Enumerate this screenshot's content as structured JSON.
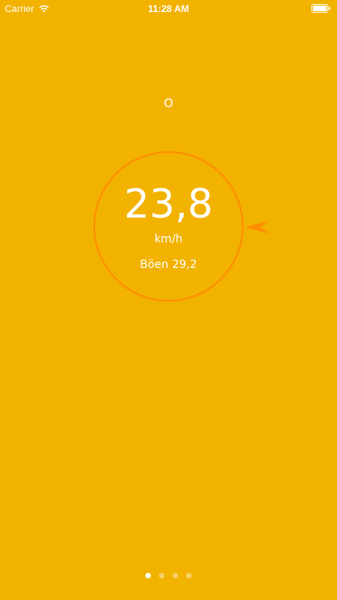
{
  "status_bar": {
    "carrier": "Carrier",
    "time": "11:28 AM",
    "wifi_icon": "wifi-icon",
    "battery_icon": "battery-icon"
  },
  "wind": {
    "direction": "O",
    "speed": "23,8",
    "unit": "km/h",
    "gust": "Böen 29,2",
    "pointer_icon": "direction-arrow-icon"
  },
  "pager": {
    "page_count": 4,
    "active_index": 0
  },
  "colors": {
    "background": "#F2B200",
    "accent": "#FF8C00",
    "text": "#FFFFFF"
  }
}
